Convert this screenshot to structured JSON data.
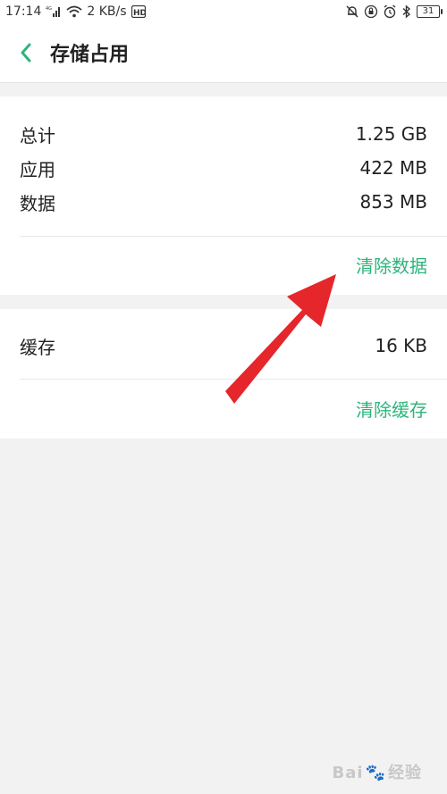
{
  "status_bar": {
    "time": "17:14",
    "network_type": "4G",
    "speed": "2 KB/s",
    "hd_badge": "HD",
    "battery": "31"
  },
  "header": {
    "title": "存储占用",
    "back_icon": "chevron-left-icon",
    "accent_color": "#2cb57a"
  },
  "storage": {
    "rows": [
      {
        "label": "总计",
        "value": "1.25 GB"
      },
      {
        "label": "应用",
        "value": "422 MB"
      },
      {
        "label": "数据",
        "value": "853 MB"
      }
    ],
    "action": "清除数据"
  },
  "cache": {
    "label": "缓存",
    "value": "16 KB",
    "action": "清除缓存"
  },
  "watermark": {
    "text": "Bai",
    "paw": "🐾",
    "suffix": "经验"
  },
  "annotation": {
    "arrow_color": "#e5262b"
  }
}
